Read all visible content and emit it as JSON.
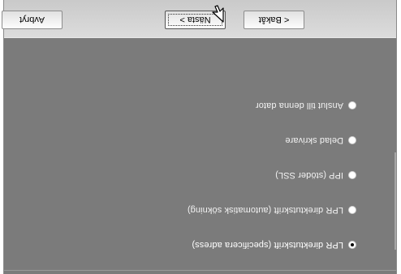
{
  "dialog": {
    "options": [
      {
        "label": "LPR direktutskrift (specificera adress)",
        "selected": true
      },
      {
        "label": "LPR direktutskrift (automatisk sökning)",
        "selected": false
      },
      {
        "label": "IPP (stöder SSL)",
        "selected": false
      },
      {
        "label": "Delad skrivare",
        "selected": false
      },
      {
        "label": "Anslut till denna dator",
        "selected": false
      }
    ],
    "buttons": {
      "cancel": "Avbryt",
      "next": "Nästa >",
      "back": "< Bakåt"
    }
  },
  "icons": {
    "cursor": "mouse-pointer-icon"
  },
  "colors": {
    "content_background": "#7b7b7b",
    "button_bar": "#d4d4d4"
  }
}
